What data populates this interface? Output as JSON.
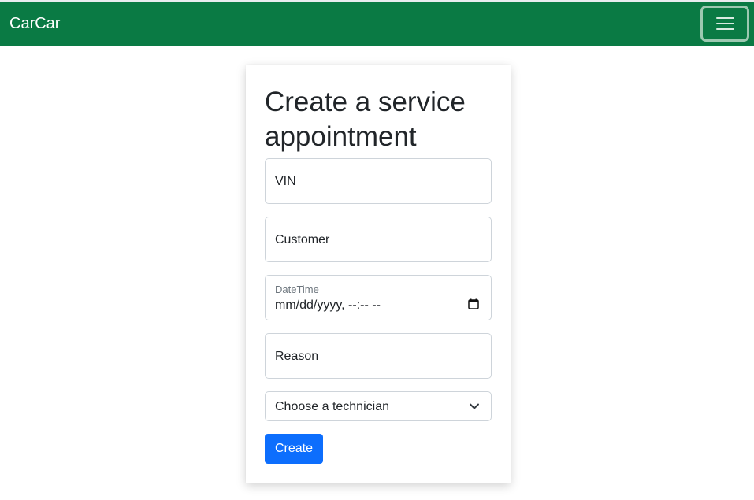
{
  "navbar": {
    "brand": "CarCar",
    "bg_color": "#0a7a44",
    "toggler_icon": "hamburger-icon"
  },
  "form": {
    "title": "Create a service appointment",
    "vin": {
      "placeholder": "VIN",
      "value": ""
    },
    "customer": {
      "placeholder": "Customer",
      "value": ""
    },
    "datetime": {
      "label": "DateTime",
      "value": "mm/dd/yyyy, --:-- --",
      "icon": "calendar-icon"
    },
    "reason": {
      "placeholder": "Reason",
      "value": ""
    },
    "technician": {
      "selected": "Choose a technician",
      "icon": "chevron-down-icon"
    },
    "submit_label": "Create",
    "submit_color": "#0d6efd"
  }
}
